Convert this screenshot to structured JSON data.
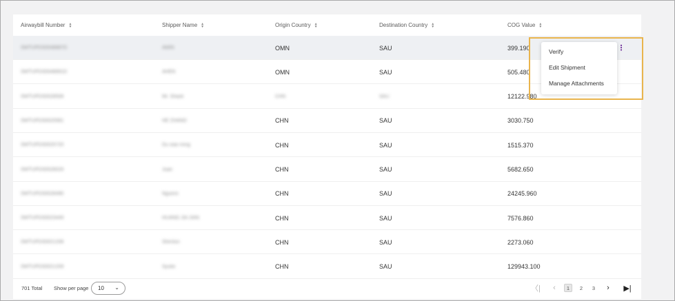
{
  "table": {
    "columns": [
      {
        "label": "Airwaybill Number"
      },
      {
        "label": "Shipper Name"
      },
      {
        "label": "Origin Country"
      },
      {
        "label": "Destination Country"
      },
      {
        "label": "COG Value"
      }
    ],
    "rows": [
      {
        "awb": "SWTUPDS0048887D",
        "shipper": "AMIN",
        "origin": "OMN",
        "destination": "SAU",
        "cog": "399.190",
        "origin_blurred": false,
        "destination_blurred": false
      },
      {
        "awb": "SWTUPDS0048891D",
        "shipper": "AHEN",
        "origin": "OMN",
        "destination": "SAU",
        "cog": "505.480",
        "origin_blurred": false,
        "destination_blurred": false
      },
      {
        "awb": "SWTUPDS0028508",
        "shipper": "Mr. Shaoli",
        "origin": "CHN",
        "destination": "SAU",
        "cog": "12122.980",
        "origin_blurred": true,
        "destination_blurred": true
      },
      {
        "awb": "SWTUPDS0020581",
        "shipper": "HE ZHAND",
        "origin": "CHN",
        "destination": "SAU",
        "cog": "3030.750",
        "origin_blurred": false,
        "destination_blurred": false
      },
      {
        "awb": "SWTUPDS0025720",
        "shipper": "Du xiao ming",
        "origin": "CHN",
        "destination": "SAU",
        "cog": "1515.370",
        "origin_blurred": false,
        "destination_blurred": false
      },
      {
        "awb": "SWTUPDS0028029",
        "shipper": "Juan",
        "origin": "CHN",
        "destination": "SAU",
        "cog": "5682.650",
        "origin_blurred": false,
        "destination_blurred": false
      },
      {
        "awb": "SWTUPDS0028490",
        "shipper": "Nguinni",
        "origin": "CHN",
        "destination": "SAU",
        "cog": "24245.960",
        "origin_blurred": false,
        "destination_blurred": false
      },
      {
        "awb": "SWTUPDS0023449",
        "shipper": "HUANG JIA JIAN",
        "origin": "CHN",
        "destination": "SAU",
        "cog": "7576.860",
        "origin_blurred": false,
        "destination_blurred": false
      },
      {
        "awb": "SWTUPDS0021208",
        "shipper": "Shenlun",
        "origin": "CHN",
        "destination": "SAU",
        "cog": "2273.060",
        "origin_blurred": false,
        "destination_blurred": false
      },
      {
        "awb": "SWTUPDS0021209",
        "shipper": "Syuke",
        "origin": "CHN",
        "destination": "SAU",
        "cog": "129943.100",
        "origin_blurred": false,
        "destination_blurred": false
      }
    ]
  },
  "row_menu": {
    "items": [
      "Verify",
      "Edit Shipment",
      "Manage Attachments"
    ],
    "kebab_icon": "more-vertical-icon"
  },
  "footer": {
    "total": "701 Total",
    "per_page_label": "Show per page",
    "per_page_value": "10",
    "pages": [
      "1",
      "2",
      "3"
    ],
    "current_page": "1"
  },
  "colors": {
    "accent": "#7a3fa0",
    "highlight_border": "#e9b44c",
    "selected_row": "#eef0f3"
  }
}
